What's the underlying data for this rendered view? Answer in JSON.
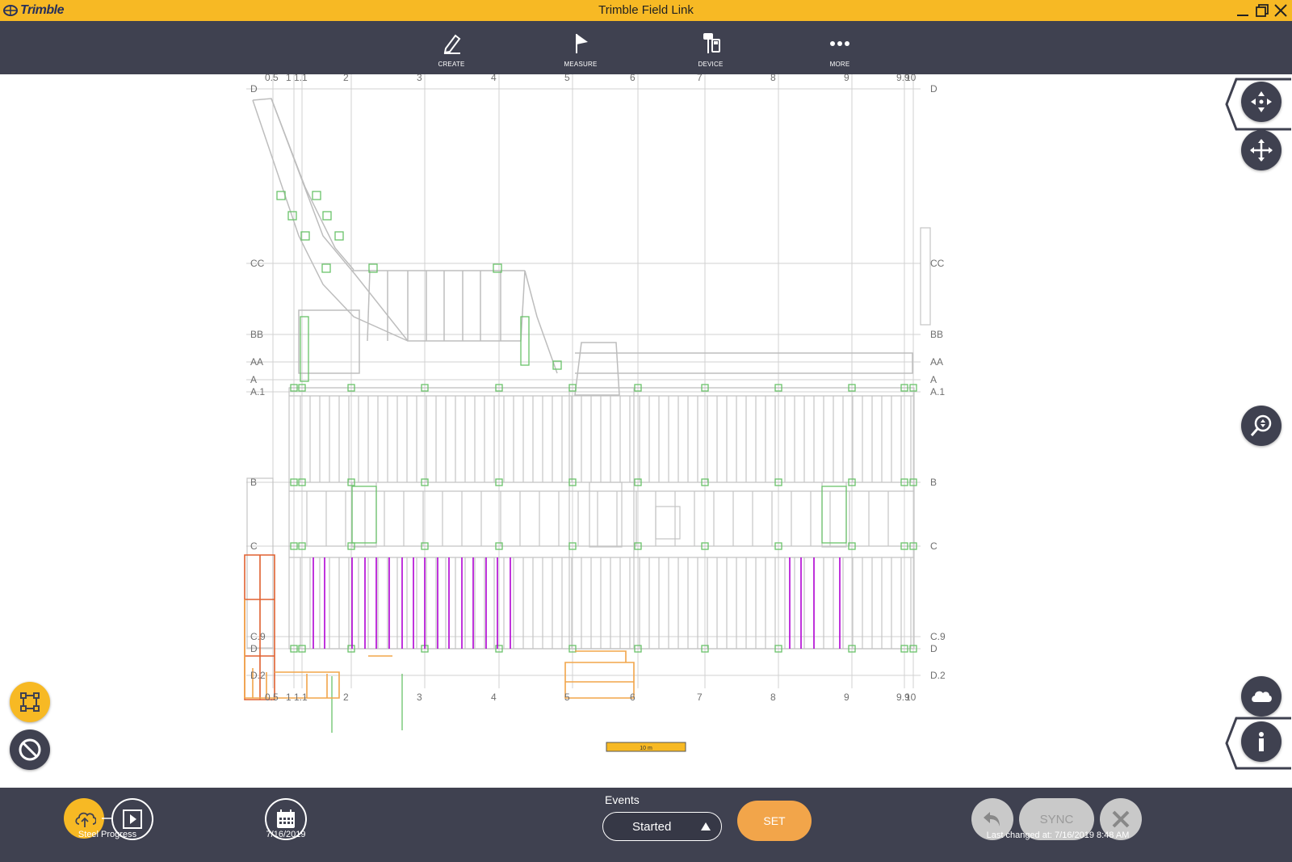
{
  "app": {
    "logo_text": "Trimble",
    "title": "Trimble Field Link"
  },
  "toolbar": {
    "items": [
      {
        "label": "CREATE",
        "icon": "pencil-icon"
      },
      {
        "label": "MEASURE",
        "icon": "flag-icon"
      },
      {
        "label": "DEVICE",
        "icon": "device-icon"
      },
      {
        "label": "MORE",
        "icon": "more-dots-icon"
      }
    ]
  },
  "drawing": {
    "column_labels": [
      "0.5",
      "1",
      "1.1",
      "2",
      "3",
      "4",
      "5",
      "6",
      "7",
      "8",
      "9",
      "9.9",
      "10"
    ],
    "row_labels_left": [
      "D",
      "CC",
      "BB",
      "AA",
      "A",
      "A.1",
      "B",
      "C",
      "C.9",
      "D",
      "D.2"
    ],
    "row_labels_right": [
      "D",
      "CC",
      "BB",
      "AA",
      "A",
      "A.1",
      "B",
      "C",
      "C.9",
      "D",
      "D.2"
    ],
    "scale_label": "10 m",
    "colors": {
      "grid": "#cfcfcf",
      "steel": "#c8c8c8",
      "connection": "#6ac26a",
      "progress": "#b000d4",
      "highlight": "#f2a54a",
      "selection": "#e06030"
    }
  },
  "right_controls": [
    "pan-icon",
    "move-icon",
    "zoom-icon",
    "cloud-icon",
    "info-icon"
  ],
  "left_controls": [
    "select-area-icon",
    "no-entry-icon"
  ],
  "bottom": {
    "layer_label": "Steel Progress",
    "date_label": "7/16/2019",
    "events_label": "Events",
    "events_value": "Started",
    "set_label": "SET",
    "sync_label": "SYNC",
    "last_changed": "Last changed at: 7/16/2019 8:48 AM"
  },
  "theme": {
    "accent": "#f7b924",
    "toolbar": "#3f4150",
    "set_button": "#f2a54a"
  }
}
